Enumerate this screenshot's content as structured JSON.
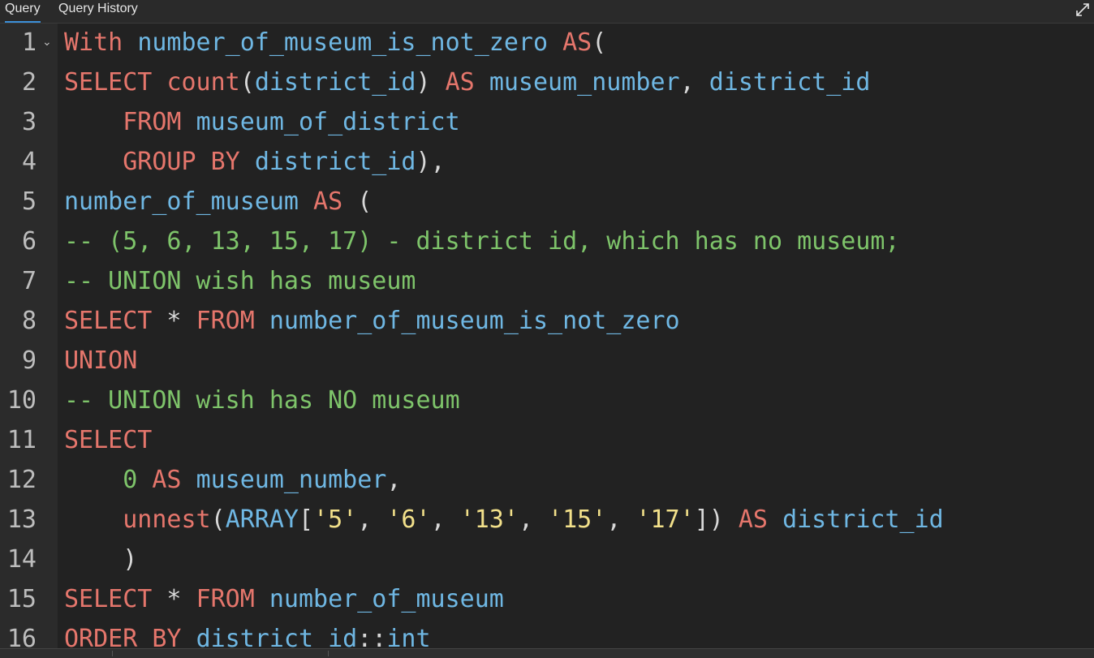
{
  "tabs": {
    "query": "Query",
    "history": "Query History"
  },
  "icons": {
    "expand": "expand-icon",
    "fold": "chevron-down-icon"
  },
  "colors": {
    "keyword": "#e5766c",
    "identifier": "#6fb7e3",
    "comment": "#7ec46a",
    "string": "#f2e08a",
    "number": "#7ec46a",
    "plain": "#d8d8d8",
    "background": "#222222",
    "gutter": "#2b2b2b",
    "tab_accent": "#3b8fd8"
  },
  "editor": {
    "lines": [
      {
        "n": "1",
        "fold": "⌄",
        "tokens": [
          [
            "kw",
            "With"
          ],
          [
            "pl",
            " "
          ],
          [
            "id",
            "number_of_museum_is_not_zero"
          ],
          [
            "pl",
            " "
          ],
          [
            "kw",
            "AS"
          ],
          [
            "pl",
            "("
          ]
        ]
      },
      {
        "n": "2",
        "tokens": [
          [
            "kw",
            "SELECT"
          ],
          [
            "pl",
            " "
          ],
          [
            "kw",
            "count"
          ],
          [
            "pl",
            "("
          ],
          [
            "id",
            "district_id"
          ],
          [
            "pl",
            ") "
          ],
          [
            "kw",
            "AS"
          ],
          [
            "pl",
            " "
          ],
          [
            "id",
            "museum_number"
          ],
          [
            "pl",
            ", "
          ],
          [
            "id",
            "district_id"
          ]
        ]
      },
      {
        "n": "3",
        "tokens": [
          [
            "pl",
            "    "
          ],
          [
            "kw",
            "FROM"
          ],
          [
            "pl",
            " "
          ],
          [
            "id",
            "museum_of_district"
          ]
        ]
      },
      {
        "n": "4",
        "tokens": [
          [
            "pl",
            "    "
          ],
          [
            "kw",
            "GROUP BY"
          ],
          [
            "pl",
            " "
          ],
          [
            "id",
            "district_id"
          ],
          [
            "pl",
            "),"
          ]
        ]
      },
      {
        "n": "5",
        "tokens": [
          [
            "id",
            "number_of_museum"
          ],
          [
            "pl",
            " "
          ],
          [
            "kw",
            "AS"
          ],
          [
            "pl",
            " ("
          ]
        ]
      },
      {
        "n": "6",
        "tokens": [
          [
            "cm",
            "-- (5, 6, 13, 15, 17) - district id, which has no museum;"
          ]
        ]
      },
      {
        "n": "7",
        "tokens": [
          [
            "cm",
            "-- UNION wish has museum"
          ]
        ]
      },
      {
        "n": "8",
        "tokens": [
          [
            "kw",
            "SELECT"
          ],
          [
            "pl",
            " * "
          ],
          [
            "kw",
            "FROM"
          ],
          [
            "pl",
            " "
          ],
          [
            "id",
            "number_of_museum_is_not_zero"
          ]
        ]
      },
      {
        "n": "9",
        "tokens": [
          [
            "kw",
            "UNION"
          ]
        ]
      },
      {
        "n": "10",
        "tokens": [
          [
            "cm",
            "-- UNION wish has NO museum"
          ]
        ]
      },
      {
        "n": "11",
        "tokens": [
          [
            "kw",
            "SELECT"
          ]
        ]
      },
      {
        "n": "12",
        "tokens": [
          [
            "pl",
            "    "
          ],
          [
            "num",
            "0"
          ],
          [
            "pl",
            " "
          ],
          [
            "kw",
            "AS"
          ],
          [
            "pl",
            " "
          ],
          [
            "id",
            "museum_number"
          ],
          [
            "pl",
            ","
          ]
        ]
      },
      {
        "n": "13",
        "tokens": [
          [
            "pl",
            "    "
          ],
          [
            "kw",
            "unnest"
          ],
          [
            "pl",
            "("
          ],
          [
            "id",
            "ARRAY"
          ],
          [
            "pl",
            "["
          ],
          [
            "str",
            "'5'"
          ],
          [
            "pl",
            ", "
          ],
          [
            "str",
            "'6'"
          ],
          [
            "pl",
            ", "
          ],
          [
            "str",
            "'13'"
          ],
          [
            "pl",
            ", "
          ],
          [
            "str",
            "'15'"
          ],
          [
            "pl",
            ", "
          ],
          [
            "str",
            "'17'"
          ],
          [
            "pl",
            "]) "
          ],
          [
            "kw",
            "AS"
          ],
          [
            "pl",
            " "
          ],
          [
            "id",
            "district_id"
          ]
        ]
      },
      {
        "n": "14",
        "tokens": [
          [
            "pl",
            "    )"
          ]
        ]
      },
      {
        "n": "15",
        "tokens": [
          [
            "kw",
            "SELECT"
          ],
          [
            "pl",
            " * "
          ],
          [
            "kw",
            "FROM"
          ],
          [
            "pl",
            " "
          ],
          [
            "id",
            "number_of_museum"
          ]
        ]
      },
      {
        "n": "16",
        "tokens": [
          [
            "kw",
            "ORDER BY"
          ],
          [
            "pl",
            " "
          ],
          [
            "id",
            "district_id"
          ],
          [
            "pl",
            "::"
          ],
          [
            "id",
            "int"
          ]
        ]
      }
    ]
  }
}
